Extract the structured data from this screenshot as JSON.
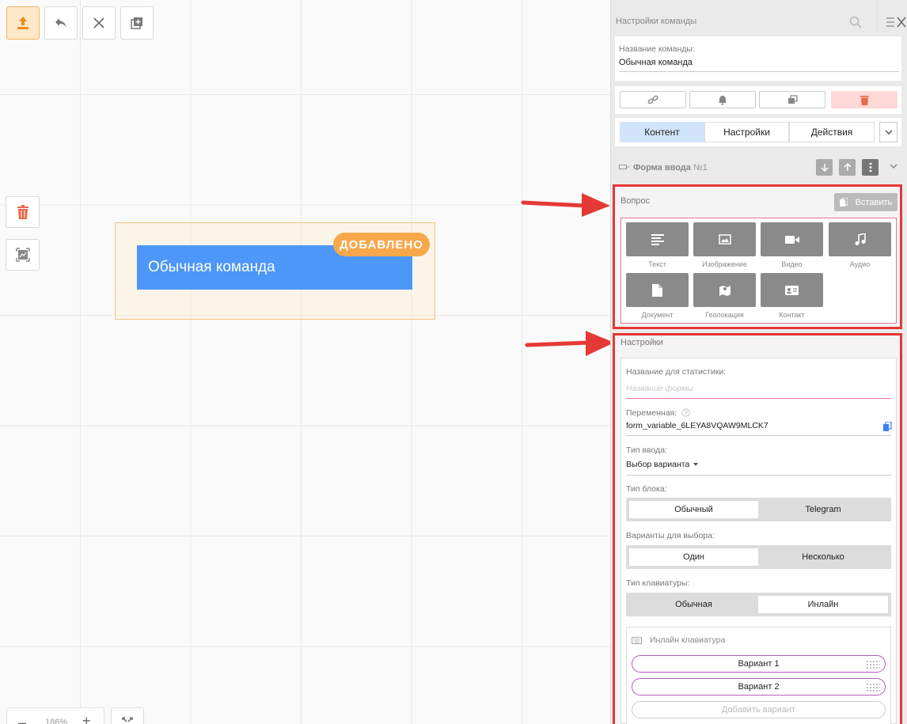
{
  "canvas": {
    "node_title": "Обычная команда",
    "node_badge": "ДОБАВЛЕНО",
    "zoom_level": "186%"
  },
  "panel": {
    "title": "Настройки команды",
    "name_label": "Название команды:",
    "name_value": "Обычная команда",
    "tabs": [
      {
        "label": "Контент",
        "active": true
      },
      {
        "label": "Настройки",
        "active": false
      },
      {
        "label": "Действия",
        "active": false
      }
    ],
    "block": {
      "title": "Форма ввода",
      "number": "№1"
    },
    "question": {
      "label": "Вопрос",
      "paste_label": "Вставить",
      "media": [
        {
          "label": "Текст",
          "icon": "text-icon"
        },
        {
          "label": "Изображение",
          "icon": "image-icon"
        },
        {
          "label": "Видео",
          "icon": "video-icon"
        },
        {
          "label": "Аудио",
          "icon": "audio-icon"
        },
        {
          "label": "Документ",
          "icon": "document-icon"
        },
        {
          "label": "Геолокация",
          "icon": "map-icon"
        },
        {
          "label": "Контакт",
          "icon": "contact-icon"
        }
      ]
    },
    "settings": {
      "label": "Настройки",
      "stat_name_label": "Название для статистики:",
      "stat_name_placeholder": "Название формы",
      "variable_label": "Переменная:",
      "variable_value": "form_variable_6LEYA8VQAW9MLCK7",
      "input_type_label": "Тип ввода:",
      "input_type_value": "Выбор варианта",
      "block_type_label": "Тип блока:",
      "block_type_options": [
        "Обычный",
        "Telegram"
      ],
      "choice_label": "Варианты для выбора:",
      "choice_options": [
        "Один",
        "Несколько"
      ],
      "keyboard_label": "Тип клавиатуры:",
      "keyboard_options": [
        "Обычная",
        "Инлайн"
      ],
      "inline_keyboard_title": "Инлайн клавиатура",
      "variants": [
        "Вариант 1",
        "Вариант 2"
      ],
      "add_variant": "Добавить вариант"
    }
  },
  "colors": {
    "accent_blue": "#4c97f7",
    "badge_orange": "#f6a84a",
    "highlight_red": "#e53935",
    "delete_red": "#ffd9d6"
  }
}
